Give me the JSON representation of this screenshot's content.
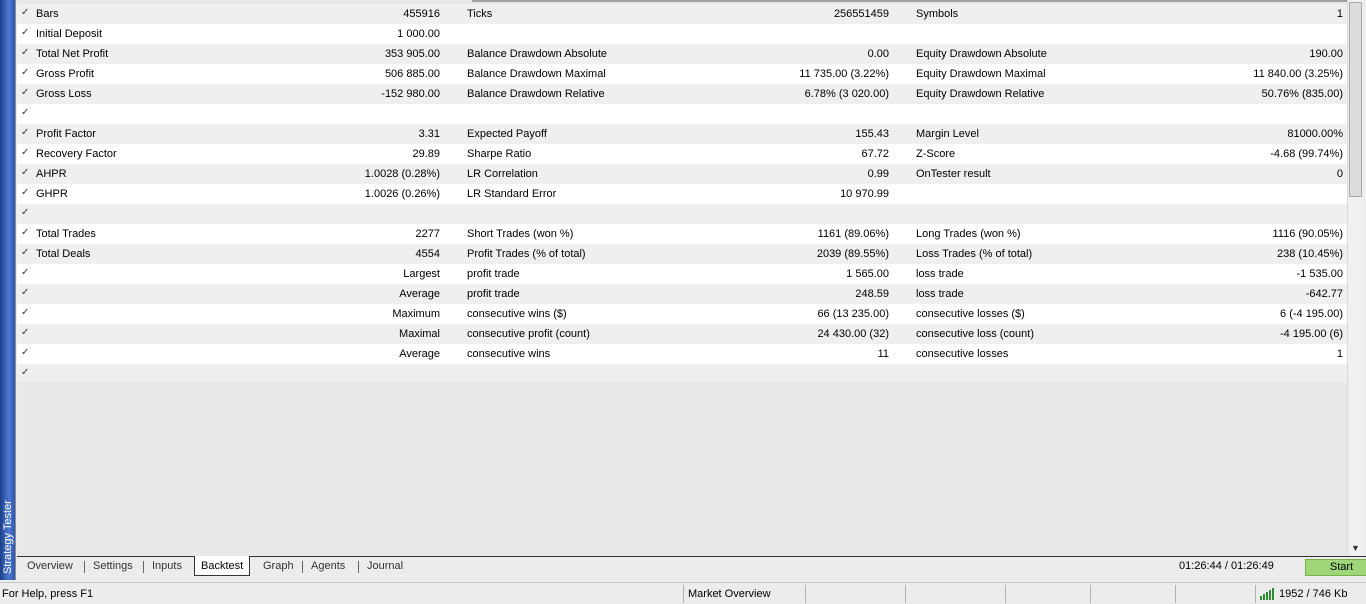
{
  "side_panel": {
    "title": "Strategy Tester"
  },
  "report": {
    "rows": [
      {
        "checked": true,
        "c1l": "Bars",
        "c1r": "455916",
        "c2l": "Ticks",
        "c2r": "256551459",
        "c3l": "Symbols",
        "c3r": "1"
      },
      {
        "checked": true,
        "c1l": "Initial Deposit",
        "c1r": "1 000.00",
        "c2l": "",
        "c2r": "",
        "c3l": "",
        "c3r": ""
      },
      {
        "checked": true,
        "c1l": "Total Net Profit",
        "c1r": "353 905.00",
        "c2l": "Balance Drawdown Absolute",
        "c2r": "0.00",
        "c3l": "Equity Drawdown Absolute",
        "c3r": "190.00"
      },
      {
        "checked": true,
        "c1l": "Gross Profit",
        "c1r": "506 885.00",
        "c2l": "Balance Drawdown Maximal",
        "c2r": "11 735.00 (3.22%)",
        "c3l": "Equity Drawdown Maximal",
        "c3r": "11 840.00 (3.25%)"
      },
      {
        "checked": true,
        "c1l": "Gross Loss",
        "c1r": "-152 980.00",
        "c2l": "Balance Drawdown Relative",
        "c2r": "6.78% (3 020.00)",
        "c3l": "Equity Drawdown Relative",
        "c3r": "50.76% (835.00)"
      },
      {
        "checked": true,
        "c1l": "",
        "c1r": "",
        "c2l": "",
        "c2r": "",
        "c3l": "",
        "c3r": ""
      },
      {
        "checked": true,
        "c1l": "Profit Factor",
        "c1r": "3.31",
        "c2l": "Expected Payoff",
        "c2r": "155.43",
        "c3l": "Margin Level",
        "c3r": "81000.00%"
      },
      {
        "checked": true,
        "c1l": "Recovery Factor",
        "c1r": "29.89",
        "c2l": "Sharpe Ratio",
        "c2r": "67.72",
        "c3l": "Z-Score",
        "c3r": "-4.68 (99.74%)"
      },
      {
        "checked": true,
        "c1l": "AHPR",
        "c1r": "1.0028 (0.28%)",
        "c2l": "LR Correlation",
        "c2r": "0.99",
        "c3l": "OnTester result",
        "c3r": "0"
      },
      {
        "checked": true,
        "c1l": "GHPR",
        "c1r": "1.0026 (0.26%)",
        "c2l": "LR Standard Error",
        "c2r": "10 970.99",
        "c3l": "",
        "c3r": ""
      },
      {
        "checked": true,
        "c1l": "",
        "c1r": "",
        "c2l": "",
        "c2r": "",
        "c3l": "",
        "c3r": ""
      },
      {
        "checked": true,
        "c1l": "Total Trades",
        "c1r": "2277",
        "c2l": "Short Trades (won %)",
        "c2r": "1161 (89.06%)",
        "c3l": "Long Trades (won %)",
        "c3r": "1116 (90.05%)"
      },
      {
        "checked": true,
        "c1l": "Total Deals",
        "c1r": "4554",
        "c2l": "Profit Trades (% of total)",
        "c2r": "2039 (89.55%)",
        "c3l": "Loss Trades (% of total)",
        "c3r": "238 (10.45%)"
      },
      {
        "checked": true,
        "c1l": "",
        "c1r": "Largest",
        "c2l": "profit trade",
        "c2r": "1 565.00",
        "c3l": "loss trade",
        "c3r": "-1 535.00"
      },
      {
        "checked": true,
        "c1l": "",
        "c1r": "Average",
        "c2l": "profit trade",
        "c2r": "248.59",
        "c3l": "loss trade",
        "c3r": "-642.77"
      },
      {
        "checked": true,
        "c1l": "",
        "c1r": "Maximum",
        "c2l": "consecutive wins ($)",
        "c2r": "66 (13 235.00)",
        "c3l": "consecutive losses ($)",
        "c3r": "6 (-4 195.00)"
      },
      {
        "checked": true,
        "c1l": "",
        "c1r": "Maximal",
        "c2l": "consecutive profit (count)",
        "c2r": "24 430.00 (32)",
        "c3l": "consecutive loss (count)",
        "c3r": "-4 195.00 (6)"
      },
      {
        "checked": true,
        "c1l": "",
        "c1r": "Average",
        "c2l": "consecutive wins",
        "c2r": "11",
        "c3l": "consecutive losses",
        "c3r": "1"
      },
      {
        "checked": true,
        "c1l": "",
        "c1r": "",
        "c2l": "",
        "c2r": "",
        "c3l": "",
        "c3r": ""
      }
    ]
  },
  "tabs": [
    {
      "label": "Overview",
      "active": false
    },
    {
      "label": "Settings",
      "active": false
    },
    {
      "label": "Inputs",
      "active": false
    },
    {
      "label": "Backtest",
      "active": true
    },
    {
      "label": "Graph",
      "active": false
    },
    {
      "label": "Agents",
      "active": false
    },
    {
      "label": "Journal",
      "active": false
    }
  ],
  "time_display": "01:26:44 / 01:26:49",
  "start_button": {
    "label": "Start",
    "color": "#9fd67a"
  },
  "statusbar": {
    "help_text": "For Help, press F1",
    "market_overview": "Market Overview",
    "connection_icon": "signal-bars-icon",
    "traffic": "1952 / 746 Kb"
  },
  "colors": {
    "side_panel": "#2b55b0",
    "row_alt": "#efefef",
    "row": "#ffffff",
    "signal": "#2e8b2e"
  }
}
